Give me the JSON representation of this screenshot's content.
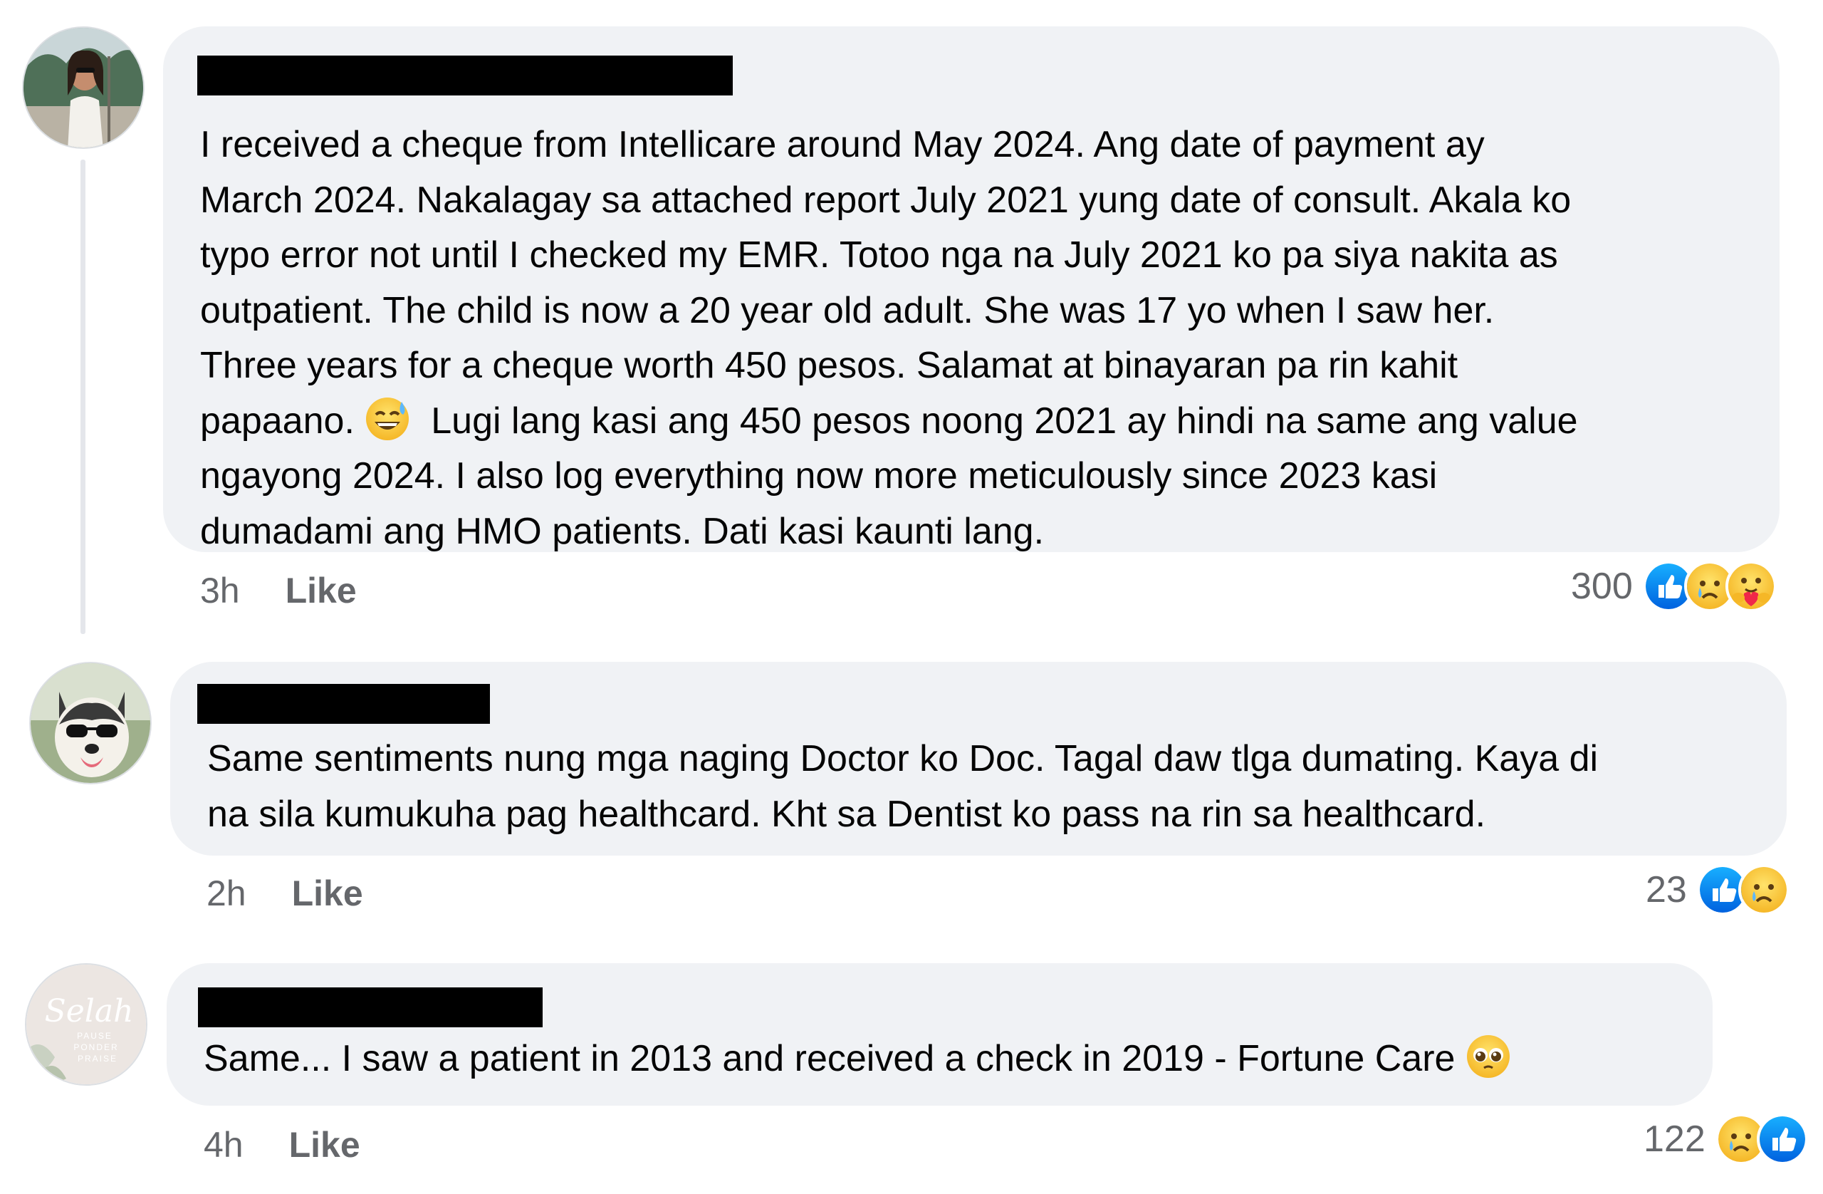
{
  "comments": [
    {
      "text_lines": [
        "I received a cheque from Intellicare around May 2024. Ang date of payment ay",
        "March 2024. Nakalagay sa attached report July 2021 yung date of consult. Akala ko",
        "typo error not until I checked my EMR. Totoo nga na July 2021 ko pa siya nakita as",
        "outpatient. The child is now a 20 year old adult. She was 17 yo when I saw her.",
        "Three years for a cheque worth 450 pesos. Salamat at binayaran pa rin kahit",
        "papaano.",
        "Lugi lang kasi ang 450 pesos noong 2021 ay hindi na same ang value",
        "ngayong 2024. I also log everything now more meticulously since 2023 kasi",
        "dumadami ang HMO patients. Dati kasi kaunti lang."
      ],
      "time": "3h",
      "like_label": "Like",
      "reaction_count": "300",
      "reactions": [
        "like-icon",
        "sad-icon",
        "care-icon"
      ]
    },
    {
      "text_lines": [
        "Same sentiments nung mga naging Doctor ko Doc. Tagal daw tlga dumating. Kaya di",
        "na sila kumukuha pag healthcard. Kht sa Dentist ko pass na rin sa healthcard."
      ],
      "time": "2h",
      "like_label": "Like",
      "reaction_count": "23",
      "reactions": [
        "like-icon",
        "sad-icon"
      ]
    },
    {
      "text_lines": [
        "Same... I saw a patient in 2013 and received a check in 2019 - Fortune Care"
      ],
      "time": "4h",
      "like_label": "Like",
      "reaction_count": "122",
      "reactions": [
        "sad-icon",
        "like-icon"
      ]
    }
  ],
  "avatar3": {
    "script": "Selah",
    "lines": [
      "PAUSE",
      "PONDER",
      "PRAISE"
    ]
  },
  "colors": {
    "bubble": "#f0f2f5",
    "meta": "#65676b",
    "like_blue": "#1877f2",
    "text": "#050505"
  }
}
